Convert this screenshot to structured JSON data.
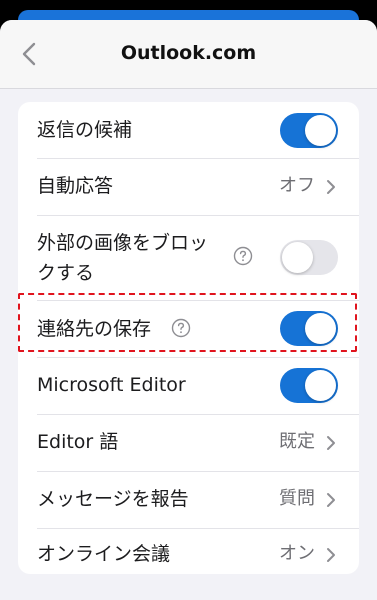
{
  "header": {
    "title": "Outlook.com"
  },
  "settings": {
    "rows": [
      {
        "label": "返信の候補",
        "toggle": "on"
      },
      {
        "label": "自動応答",
        "value": "オフ"
      },
      {
        "label_line1": "外部の画像をブロッ",
        "label_line2": "クする",
        "toggle": "off"
      },
      {
        "label": "連絡先の保存",
        "toggle": "on"
      },
      {
        "label": "Microsoft Editor",
        "toggle": "on"
      },
      {
        "label": "Editor 語",
        "value": "既定"
      },
      {
        "label": "メッセージを報告",
        "value": "質問"
      },
      {
        "label": "オンライン会議",
        "value": "オン"
      }
    ]
  },
  "colors": {
    "accent": "#1673d6",
    "highlight": "#e0141e"
  },
  "icons": {
    "back": "chevron-left-icon",
    "help": "question-circle-icon",
    "disclosure": "chevron-right-icon"
  }
}
